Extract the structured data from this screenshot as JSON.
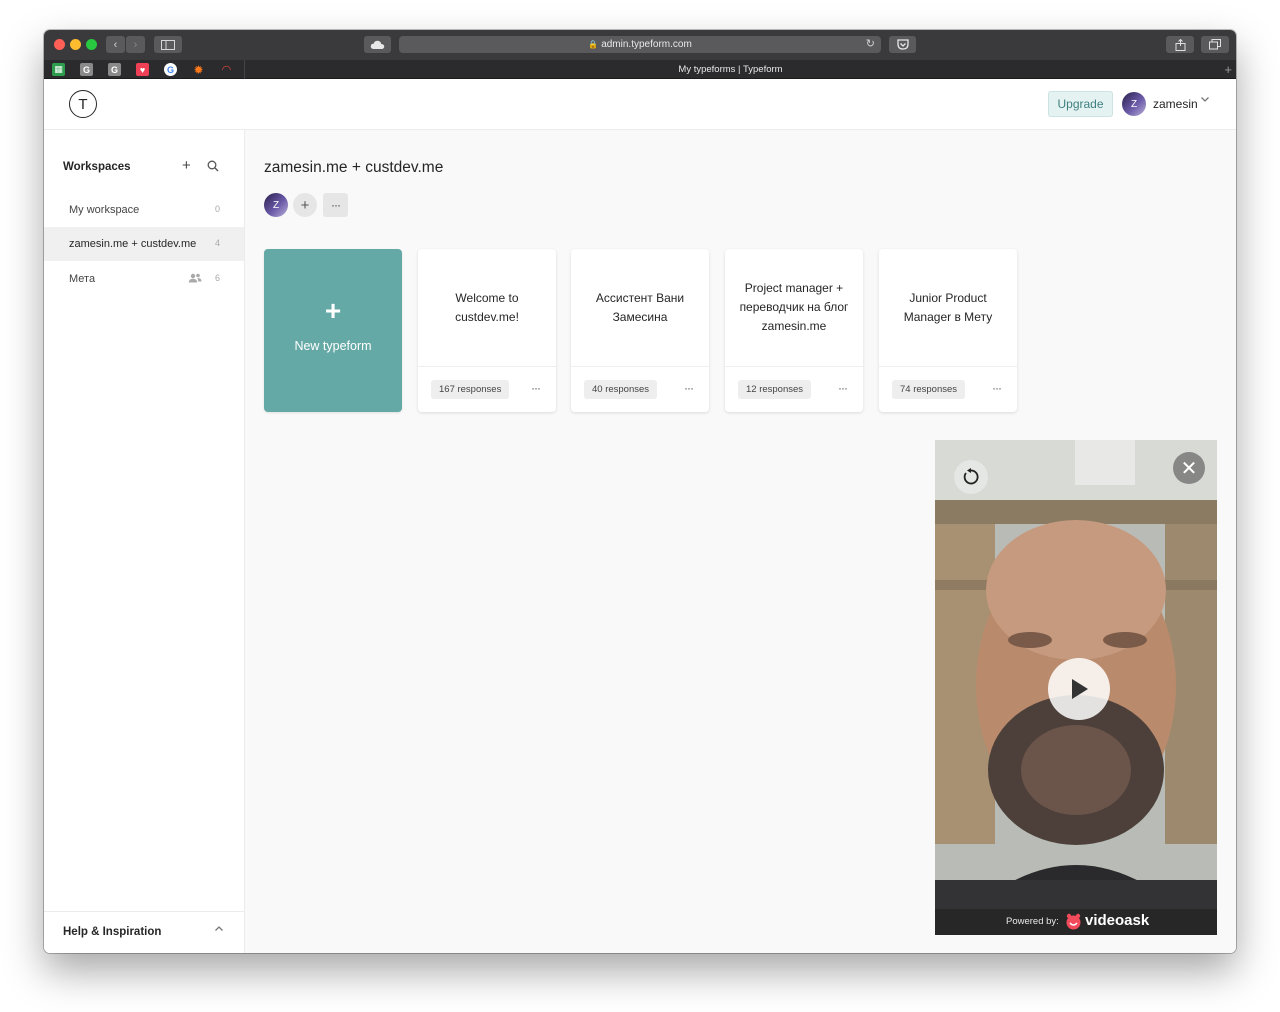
{
  "browser": {
    "url": "admin.typeform.com",
    "tab_title": "My typeforms | Typeform",
    "nav_back": "‹",
    "nav_forward": "›",
    "new_tab": "+"
  },
  "header": {
    "logo_letter": "T",
    "upgrade_label": "Upgrade",
    "user_initial": "Z",
    "username": "zamesin"
  },
  "sidebar": {
    "title": "Workspaces",
    "add": "+",
    "items": [
      {
        "label": "My workspace",
        "count": "0"
      },
      {
        "label": "zamesin.me + custdev.me",
        "count": "4"
      },
      {
        "label": "Мета",
        "count": "6"
      }
    ],
    "help_label": "Help & Inspiration"
  },
  "workspace": {
    "title": "zamesin.me + custdev.me",
    "member_initial": "Z",
    "add": "+",
    "more": "···"
  },
  "new_typeform": {
    "plus": "+",
    "label": "New typeform"
  },
  "forms": [
    {
      "title": "Welcome to custdev.me!",
      "responses": "167 responses",
      "more": "···"
    },
    {
      "title": "Ассистент Вани Замесина",
      "responses": "40 responses",
      "more": "···"
    },
    {
      "title": "Project manager + переводчик на блог zamesin.me",
      "responses": "12 responses",
      "more": "···"
    },
    {
      "title": "Junior Product Manager в Мету",
      "responses": "74 responses",
      "more": "···"
    }
  ],
  "videoask": {
    "close": "✕",
    "powered_by": "Powered by:",
    "brand": "videoask"
  },
  "colors": {
    "accent": "#65a9a6",
    "upgrade_bg": "#e4f2f2",
    "upgrade_text": "#3f7f7f",
    "browser_chrome": "#3a3a3c"
  }
}
